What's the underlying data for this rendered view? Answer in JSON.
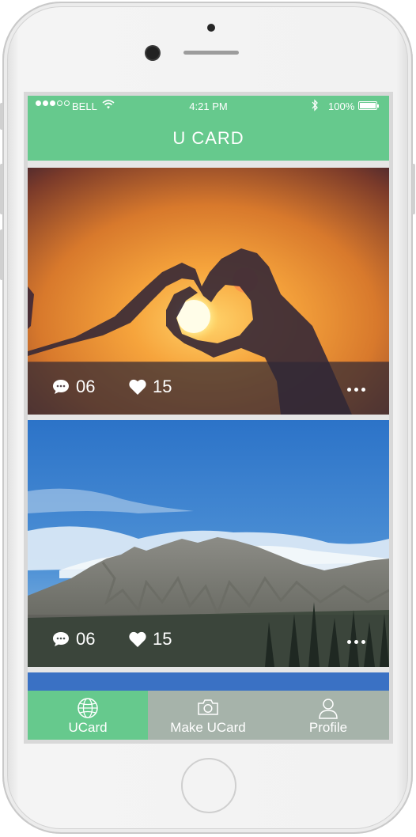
{
  "status_bar": {
    "carrier": "BELL",
    "time": "4:21 PM",
    "battery": "100%",
    "signal_icon": "signal-dots-icon",
    "wifi_icon": "wifi-icon",
    "bluetooth_icon": "bluetooth-icon",
    "battery_icon": "battery-icon"
  },
  "header": {
    "title": "U CARD"
  },
  "cards": [
    {
      "comments": "06",
      "likes": "15",
      "photo": "heart-hands-sunset",
      "more_icon": "more-dots-icon"
    },
    {
      "comments": "06",
      "likes": "15",
      "photo": "mountain-blue-sky",
      "more_icon": "more-dots-icon"
    }
  ],
  "tabs": [
    {
      "label": "UCard",
      "icon": "globe-icon",
      "active": true
    },
    {
      "label": "Make UCard",
      "icon": "camera-icon",
      "active": false
    },
    {
      "label": "Profile",
      "icon": "person-icon",
      "active": false
    }
  ],
  "colors": {
    "accent": "#66c98d",
    "tab_inactive": "#a6b3aa"
  }
}
